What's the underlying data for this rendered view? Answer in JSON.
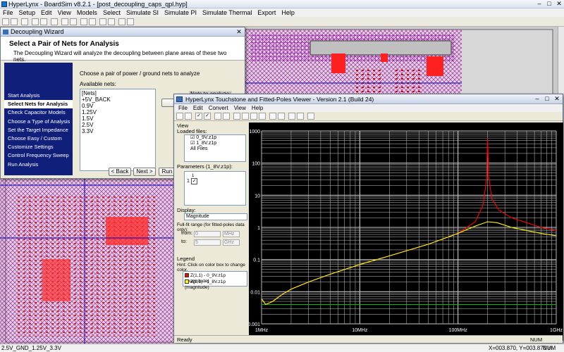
{
  "app": {
    "title": "HyperLynx - BoardSim v8.2.1 - [post_decoupling_caps_qpl.hyp]",
    "menu": [
      "File",
      "Setup",
      "Edit",
      "View",
      "Models",
      "Select",
      "Simulate SI",
      "Simulate PI",
      "Simulate Thermal",
      "Export",
      "Help"
    ],
    "status_left": "2.5V_GND_1.25V_3.3V",
    "status_coords": "X=003.870, Y=003.870 in",
    "status_num": "NUM"
  },
  "wizard": {
    "title": "Decoupling Wizard",
    "header_title": "Select a Pair of Nets for Analysis",
    "header_desc": "The Decoupling Wizard will analyze the decoupling between plane areas of these two nets.",
    "steps": [
      "Start Analysis",
      "Select Nets for Analysis",
      "Check Capacitor Models",
      "Choose a Type of Analysis",
      "Set the Target Impedance",
      "Choose Easy / Custom",
      "Customize Settings",
      "Control Frequency Sweep",
      "Run Analysis"
    ],
    "active_step": 1,
    "prompt": "Choose a pair of power / ground nets to analyze",
    "available_label": "Available nets:",
    "nets": [
      "[Nets]",
      "+5V_BACK",
      "0.9V",
      "1.25V",
      "1.5V",
      "2.5V",
      "3.3V"
    ],
    "back_label": "< Back",
    "next_label": "Next >",
    "run_label": "Run Ana",
    "nets_to_analyze": "Nets to analyze:"
  },
  "viewer": {
    "title": "HyperLynx Touchstone and Fitted-Poles Viewer - Version 2.1 (Build 24)",
    "menu": [
      "File",
      "Edit",
      "Convert",
      "View",
      "Help"
    ],
    "view_label": "View",
    "loaded_label": "Loaded files:",
    "files": [
      "0_9V.z1p",
      "1_8V.z1p",
      "All Files"
    ],
    "params_label": "Parameters (1_8V.z1p):",
    "param_col": "1",
    "param_row": "1",
    "display_label": "Display:",
    "display_value": "Magnitude",
    "fit_range_label": "Full-fit range (for fitted-poles data only):",
    "from_label": "from:",
    "from_value": "0",
    "from_unit": "MHz",
    "to_label": "to:",
    "to_value": "5",
    "to_unit": "GHz",
    "legend_label": "Legend",
    "hint": "Hint:  Click on color box to change color.",
    "legend": [
      {
        "label": "Z(1,1) - 0_9V.z1p (magnitude)",
        "color": "#ff0000"
      },
      {
        "label": "Z(1,1) - 1_8V.z1p (magnitude)",
        "color": "#ffff00"
      }
    ],
    "status_ready": "Ready",
    "status_num": "NUM"
  },
  "chart_data": {
    "type": "line",
    "x_scale": "log",
    "y_scale": "log",
    "xlim": [
      "1MHz",
      "1GHz"
    ],
    "ylim": [
      0.001,
      1000
    ],
    "x_ticks": [
      "1MHz",
      "10MHz",
      "100MHz",
      "1GHz"
    ],
    "y_ticks": [
      "1000",
      "100",
      "10",
      "1",
      "0.1",
      "0.01",
      "0.001"
    ],
    "grid": true,
    "series": [
      {
        "name": "Z(1,1) - 0_9V.z1p (magnitude)",
        "color": "#ff0000",
        "x_mhz": [
          1,
          1.1,
          1.3,
          1.6,
          2,
          3,
          5,
          10,
          20,
          50,
          100,
          150,
          180,
          195,
          200,
          205,
          220,
          260,
          350,
          500,
          700,
          1000
        ],
        "y": [
          0.006,
          0.004,
          0.005,
          0.008,
          0.012,
          0.02,
          0.035,
          0.07,
          0.13,
          0.3,
          0.65,
          1.5,
          5,
          30,
          600,
          40,
          8,
          3.5,
          2,
          1.4,
          1.0,
          0.8
        ]
      },
      {
        "name": "Z(1,1) - 1_8V.z1p (magnitude)",
        "color": "#ffff00",
        "x_mhz": [
          1,
          1.1,
          1.3,
          1.6,
          2,
          3,
          5,
          10,
          20,
          50,
          100,
          150,
          200,
          250,
          350,
          500,
          700,
          1000
        ],
        "y": [
          0.006,
          0.004,
          0.005,
          0.008,
          0.012,
          0.02,
          0.035,
          0.07,
          0.13,
          0.3,
          0.65,
          1.1,
          1.5,
          1.4,
          1.0,
          0.8,
          0.65,
          0.55
        ]
      },
      {
        "name": "",
        "color": "#00c000",
        "x_mhz": [
          1,
          1000
        ],
        "y": [
          0.004,
          0.004
        ]
      }
    ]
  }
}
